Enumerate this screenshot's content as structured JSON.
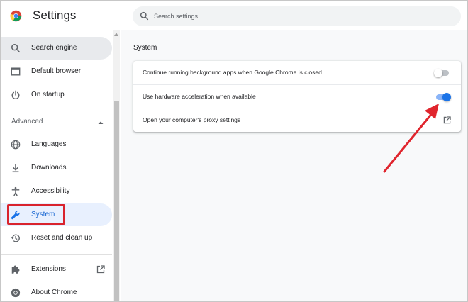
{
  "header": {
    "title": "Settings",
    "search_placeholder": "Search settings",
    "search_value": ""
  },
  "sidebar": {
    "items_top": [
      {
        "label": "Search engine",
        "icon": "search-icon"
      },
      {
        "label": "Default browser",
        "icon": "browser-icon"
      },
      {
        "label": "On startup",
        "icon": "power-icon"
      }
    ],
    "advanced_label": "Advanced",
    "items_advanced": [
      {
        "label": "Languages",
        "icon": "globe-icon"
      },
      {
        "label": "Downloads",
        "icon": "download-icon"
      },
      {
        "label": "Accessibility",
        "icon": "accessibility-icon"
      },
      {
        "label": "System",
        "icon": "wrench-icon"
      },
      {
        "label": "Reset and clean up",
        "icon": "history-icon"
      }
    ],
    "items_bottom": [
      {
        "label": "Extensions",
        "icon": "puzzle-icon"
      },
      {
        "label": "About Chrome",
        "icon": "chrome-icon"
      }
    ]
  },
  "main": {
    "section_title": "System",
    "rows": [
      {
        "text": "Continue running background apps when Google Chrome is closed",
        "control": "toggle",
        "enabled": false
      },
      {
        "text": "Use hardware acceleration when available",
        "control": "toggle",
        "enabled": true
      },
      {
        "text": "Open your computer's proxy settings",
        "control": "external-link-icon"
      }
    ]
  },
  "colors": {
    "accent": "#1a73e8",
    "active_bg": "#e8f0fe",
    "hover_bg": "#e8eaed",
    "annotation_red": "#d9232d"
  }
}
